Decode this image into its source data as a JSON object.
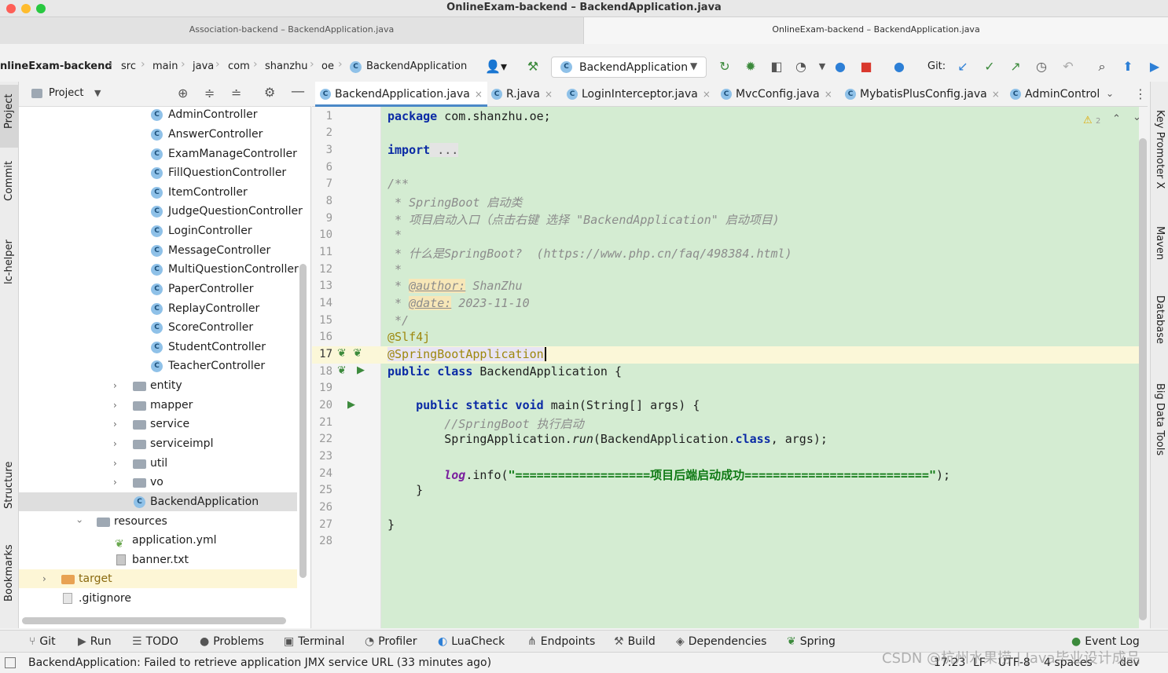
{
  "window": {
    "title": "OnlineExam-backend – BackendApplication.java",
    "tabs": [
      "Association-backend – BackendApplication.java",
      "OnlineExam-backend – BackendApplication.java"
    ]
  },
  "breadcrumbs": [
    "nlineExam-backend",
    "src",
    "main",
    "java",
    "com",
    "shanzhu",
    "oe",
    "BackendApplication"
  ],
  "toolbar": {
    "run_config": "BackendApplication",
    "git_label": "Git:"
  },
  "left_strip": [
    "Project",
    "Commit",
    "lc-helper",
    "Structure",
    "Bookmarks"
  ],
  "right_strip": [
    "Key Promoter X",
    "Maven",
    "Database",
    "Big Data Tools"
  ],
  "project_panel": {
    "title": "Project",
    "items": [
      {
        "label": "AdminController",
        "kind": "class"
      },
      {
        "label": "AnswerController",
        "kind": "class"
      },
      {
        "label": "ExamManageController",
        "kind": "class"
      },
      {
        "label": "FillQuestionController",
        "kind": "class"
      },
      {
        "label": "ItemController",
        "kind": "class"
      },
      {
        "label": "JudgeQuestionController",
        "kind": "class"
      },
      {
        "label": "LoginController",
        "kind": "class"
      },
      {
        "label": "MessageController",
        "kind": "class"
      },
      {
        "label": "MultiQuestionController",
        "kind": "class"
      },
      {
        "label": "PaperController",
        "kind": "class"
      },
      {
        "label": "ReplayController",
        "kind": "class"
      },
      {
        "label": "ScoreController",
        "kind": "class"
      },
      {
        "label": "StudentController",
        "kind": "class"
      },
      {
        "label": "TeacherController",
        "kind": "class"
      },
      {
        "label": "entity",
        "kind": "folder"
      },
      {
        "label": "mapper",
        "kind": "folder"
      },
      {
        "label": "service",
        "kind": "folder"
      },
      {
        "label": "serviceimpl",
        "kind": "folder"
      },
      {
        "label": "util",
        "kind": "folder"
      },
      {
        "label": "vo",
        "kind": "folder"
      },
      {
        "label": "BackendApplication",
        "kind": "app"
      },
      {
        "label": "resources",
        "kind": "folder-open"
      },
      {
        "label": "application.yml",
        "kind": "yml"
      },
      {
        "label": "banner.txt",
        "kind": "txt"
      },
      {
        "label": "target",
        "kind": "folder-orange"
      },
      {
        "label": ".gitignore",
        "kind": "file"
      }
    ]
  },
  "editor_tabs": [
    {
      "label": "BackendApplication.java",
      "active": true
    },
    {
      "label": "R.java",
      "active": false
    },
    {
      "label": "LoginInterceptor.java",
      "active": false
    },
    {
      "label": "MvcConfig.java",
      "active": false
    },
    {
      "label": "MybatisPlusConfig.java",
      "active": false
    },
    {
      "label": "AdminControl",
      "active": false
    }
  ],
  "editor": {
    "warning_count": "2",
    "line_numbers": [
      "1",
      "2",
      "3",
      "6",
      "7",
      "8",
      "9",
      "10",
      "11",
      "12",
      "13",
      "14",
      "15",
      "16",
      "17",
      "18",
      "19",
      "20",
      "21",
      "22",
      "23",
      "24",
      "25",
      "26",
      "27",
      "28"
    ],
    "lines": {
      "l1_kw": "package",
      "l1_rest": " com.shanzhu.oe;",
      "l3_kw": "import",
      "l3_rest": " ...",
      "l7": "/**",
      "l8": " * SpringBoot 启动类",
      "l9": " * 项目启动入口（点击右键 选择 \"BackendApplication\" 启动项目)",
      "l10": " *",
      "l11": " * 什么是SpringBoot?  (https://www.php.cn/faq/498384.html)",
      "l12": " *",
      "l13_pre": " * ",
      "l13_tag": "@author:",
      "l13_val": " ShanZhu",
      "l14_pre": " * ",
      "l14_tag": "@date:",
      "l14_val": " 2023-11-10",
      "l15": " */",
      "l16": "@Slf4j",
      "l17": "@SpringBootApplication",
      "l18_kw": "public class",
      "l18_rest": " BackendApplication {",
      "l20_kw": "    public static void",
      "l20_rest": " main(String[] args) {",
      "l21": "        //SpringBoot 执行启动",
      "l22_a": "        SpringApplication.",
      "l22_b": "run",
      "l22_c": "(BackendApplication.",
      "l22_d": "class",
      "l22_e": ", args);",
      "l24_a": "        ",
      "l24_b": "log",
      "l24_c": ".info(",
      "l24_d": "\"===================项目后端启动成功==========================\"",
      "l24_e": ");",
      "l25": "    }",
      "l27": "}"
    }
  },
  "bottom_tools": [
    "Git",
    "Run",
    "TODO",
    "Problems",
    "Terminal",
    "Profiler",
    "LuaCheck",
    "Endpoints",
    "Build",
    "Dependencies",
    "Spring",
    "Event Log"
  ],
  "status": {
    "message": "BackendApplication: Failed to retrieve application JMX service URL (33 minutes ago)",
    "position": "17:23",
    "line_sep": "LF",
    "encoding": "UTF-8",
    "indent": "4 spaces",
    "branch": "dev"
  },
  "watermark": "CSDN @杭州水果捞 | Java毕业设计成品"
}
